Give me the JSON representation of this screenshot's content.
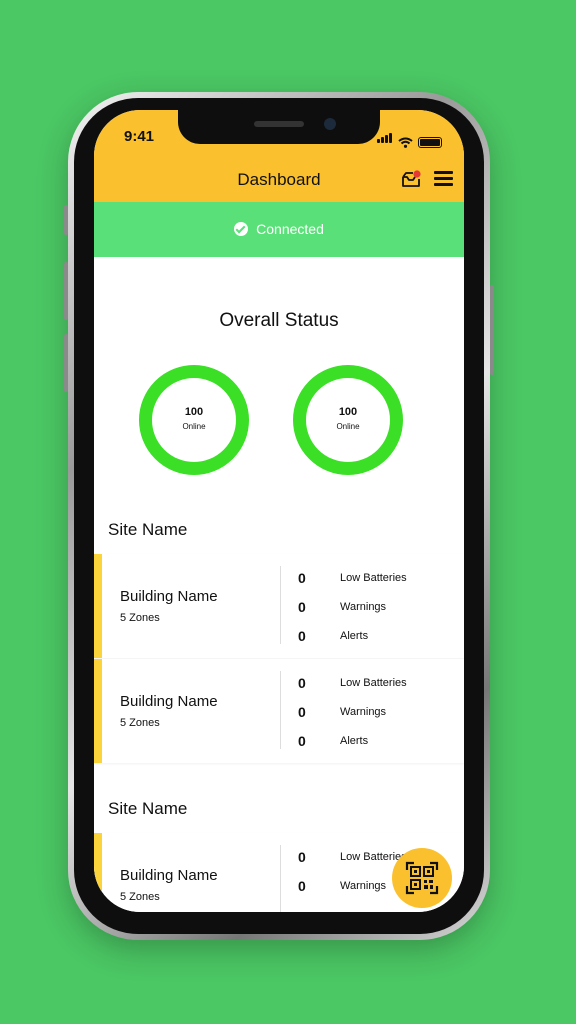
{
  "status_bar": {
    "time": "9:41"
  },
  "header": {
    "title": "Dashboard"
  },
  "banner": {
    "text": "Connected"
  },
  "overall": {
    "title": "Overall Status",
    "rings": [
      {
        "value": "100",
        "label": "Online"
      },
      {
        "value": "100",
        "label": "Online"
      }
    ]
  },
  "sites": [
    {
      "name": "Site Name",
      "buildings": [
        {
          "name": "Building Name",
          "zones": "5 Zones",
          "stats": [
            {
              "value": "0",
              "label": "Low Batteries"
            },
            {
              "value": "0",
              "label": "Warnings"
            },
            {
              "value": "0",
              "label": "Alerts"
            }
          ]
        },
        {
          "name": "Building Name",
          "zones": "5 Zones",
          "stats": [
            {
              "value": "0",
              "label": "Low Batteries"
            },
            {
              "value": "0",
              "label": "Warnings"
            },
            {
              "value": "0",
              "label": "Alerts"
            }
          ]
        }
      ]
    },
    {
      "name": "Site Name",
      "buildings": [
        {
          "name": "Building Name",
          "zones": "5 Zones",
          "stats": [
            {
              "value": "0",
              "label": "Low Batteries"
            },
            {
              "value": "0",
              "label": "Warnings"
            }
          ]
        }
      ]
    }
  ],
  "icons": {
    "inbox": "inbox-icon",
    "menu": "menu-icon",
    "check": "check-circle-icon",
    "qr": "qr-code-icon"
  },
  "colors": {
    "background": "#4bc764",
    "header": "#fbc02d",
    "banner": "#5ae079",
    "ring": "#3adf26",
    "accent_bar": "#fbd33a",
    "badge": "#e53935"
  }
}
